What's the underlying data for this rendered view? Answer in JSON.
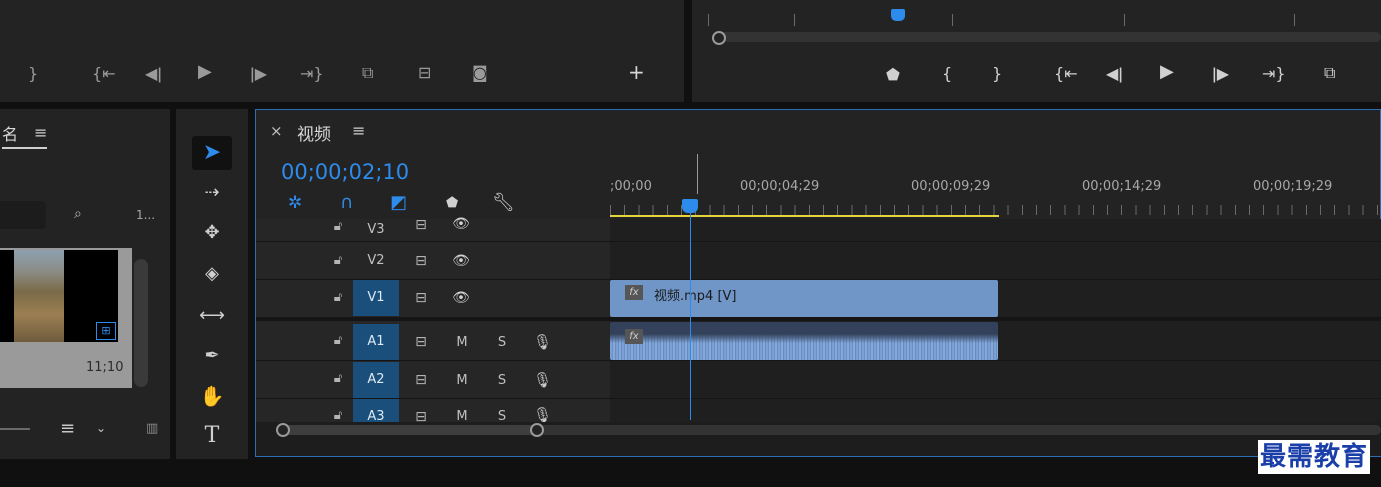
{
  "source_monitor": {
    "controls": [
      "}",
      "{←",
      "◀|",
      "▶",
      "|▶",
      "→}",
      "insert",
      "overwrite",
      "camera",
      "+"
    ]
  },
  "program_monitor": {
    "controls": [
      "marker",
      "{",
      "}",
      "{←",
      "◀|",
      "▶",
      "|▶",
      "→}",
      "lift"
    ]
  },
  "project_panel": {
    "tab_label": "名",
    "clip_duration": "11;10",
    "zoom_ellipsis": "1..."
  },
  "tools": [
    "selection",
    "track-select-forward",
    "ripple-edit",
    "razor",
    "slip",
    "pen",
    "hand",
    "type"
  ],
  "timeline": {
    "close_glyph": "×",
    "sequence_name": "视频",
    "timecode": "00;00;02;10",
    "ruler_labels": [
      ";00;00",
      "00;00;04;29",
      "00;00;09;29",
      "00;00;14;29",
      "00;00;19;29"
    ],
    "tracks": {
      "V3": "V3",
      "V2": "V2",
      "V1": "V1",
      "A1": "A1",
      "A2": "A2",
      "A3": "A3",
      "mute": "M",
      "solo": "S"
    },
    "video_clip_label": "视频.mp4 [V]",
    "fx_badge": "fx"
  },
  "watermark": "最需教育",
  "colors": {
    "accent": "#2d8ceb",
    "clip_video": "#7096c8",
    "clip_audio": "#5a7aab",
    "track_selected": "#1b4f7b",
    "work_area": "#e5d43a"
  }
}
